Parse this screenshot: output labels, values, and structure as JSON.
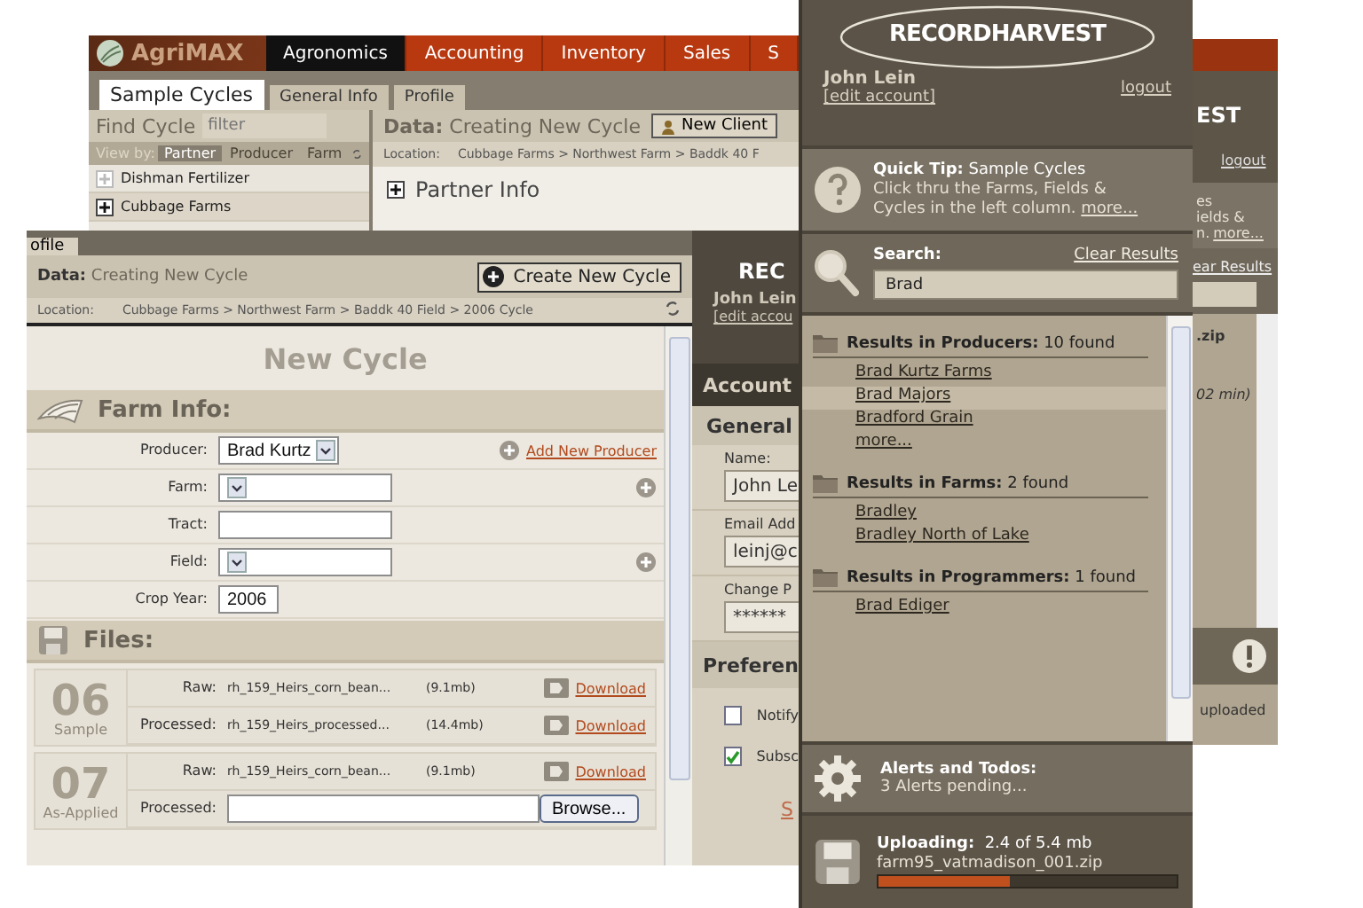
{
  "agrimax_window": {
    "app_name": "AgriMAX",
    "module_tabs": [
      {
        "label": "Agronomics",
        "selected": true
      },
      {
        "label": "Accounting",
        "selected": false
      },
      {
        "label": "Inventory",
        "selected": false
      },
      {
        "label": "Sales",
        "selected": false
      },
      {
        "label": "S",
        "selected": false
      }
    ],
    "page_tabs": [
      {
        "label": "Sample Cycles",
        "selected": true
      },
      {
        "label": "General Info",
        "selected": false
      },
      {
        "label": "Profile",
        "selected": false
      }
    ],
    "find_title": "Find Cycle",
    "filter": {
      "placeholder": "filter"
    },
    "view_by_label": "View by:",
    "view_by": [
      {
        "label": "Partner",
        "selected": true
      },
      {
        "label": "Producer",
        "selected": false
      },
      {
        "label": "Farm",
        "selected": false
      }
    ],
    "items": [
      {
        "label": "Dishman Fertilizer",
        "disabled": true
      },
      {
        "label": "Cubbage Farms",
        "disabled": false
      }
    ],
    "data_label": "Data:",
    "data_title": "Creating New Cycle",
    "new_client_button": "New Client",
    "location_label": "Location:",
    "location": "Cubbage Farms > Northwest Farm > Baddk 40 F",
    "section": "Partner Info"
  },
  "back_sidebar": {
    "logo_fragment": "EST",
    "logout": "logout",
    "tip_lines": [
      "es",
      "ields &"
    ],
    "tip_end": "n.",
    "more": "more...",
    "clear_fragment": "ear Results",
    "result_lines": [
      ".zip",
      "02 min)"
    ],
    "status": "uploaded"
  },
  "account_window": {
    "logo_fragment": "REC",
    "user": "John Lein",
    "edit_link": "[edit accou",
    "title": "Account",
    "section": "General",
    "fields": [
      {
        "label": "Name:",
        "value": "John Le"
      },
      {
        "label": "Email Add",
        "value": "leinj@c"
      },
      {
        "label": "Change P",
        "value": "******"
      }
    ],
    "preferences_title": "Preferen",
    "preferences": [
      {
        "label": "Notify",
        "checked": false
      },
      {
        "label": "Subsc",
        "checked": true
      }
    ],
    "link_fragment": "S"
  },
  "new_cycle_window": {
    "tab_fragment": "ofile",
    "data_label": "Data:",
    "data_title": "Creating New Cycle",
    "create_button": "Create New Cycle",
    "location_label": "Location:",
    "location": "Cubbage Farms > Northwest Farm > Baddk 40 Field > 2006 Cycle",
    "heading": "New Cycle",
    "farm_info": {
      "title": "Farm Info:",
      "fields": [
        {
          "kind": "select",
          "label": "Producer:",
          "value": "Brad Kurtz",
          "add_link": "Add New Producer"
        },
        {
          "kind": "select",
          "label": "Farm:",
          "add_button": true
        },
        {
          "kind": "text",
          "label": "Tract:"
        },
        {
          "kind": "select",
          "label": "Field:",
          "add_button": true
        },
        {
          "kind": "text",
          "label": "Crop Year:",
          "value": "2006"
        }
      ]
    },
    "files": {
      "title": "Files:",
      "groups": [
        {
          "number": "06",
          "type": "Sample",
          "files": [
            {
              "kind": "file",
              "label": "Raw:",
              "name": "rh_159_Heirs_corn_bean...",
              "size": "(9.1mb)",
              "link": "Download"
            },
            {
              "kind": "file",
              "label": "Processed:",
              "name": "rh_159_Heirs_processed...",
              "size": "(14.4mb)",
              "link": "Download"
            }
          ]
        },
        {
          "number": "07",
          "type": "As-Applied",
          "files": [
            {
              "kind": "file",
              "label": "Raw:",
              "name": "rh_159_Heirs_corn_bean...",
              "size": "(9.1mb)",
              "link": "Download"
            },
            {
              "kind": "upload",
              "label": "Processed:",
              "button": "Browse..."
            }
          ]
        }
      ]
    }
  },
  "sidebar": {
    "logo": "RECORDHARVEST",
    "user": "John Lein",
    "edit_link": "[edit account]",
    "logout": "logout",
    "quick_tip": {
      "label": "Quick Tip:",
      "title": "Sample Cycles",
      "text": "Click thru the Farms, Fields & Cycles in the left column.",
      "more": "more..."
    },
    "search": {
      "label": "Search:",
      "clear": "Clear Results",
      "value": "Brad"
    },
    "results": [
      {
        "title": "Results in Producers:",
        "count": "10 found",
        "items": [
          {
            "label": "Brad Kurtz Farms",
            "selected": false
          },
          {
            "label": "Brad Majors",
            "selected": true
          },
          {
            "label": "Bradford Grain",
            "selected": false
          }
        ],
        "more": "more..."
      },
      {
        "title": "Results in Farms:",
        "count": "2 found",
        "items": [
          {
            "label": "Bradley",
            "selected": false
          },
          {
            "label": "Bradley North of Lake",
            "selected": false
          }
        ]
      },
      {
        "title": "Results in Programmers:",
        "count": "1 found",
        "items": [
          {
            "label": "Brad Ediger",
            "selected": false
          }
        ]
      }
    ],
    "alerts": {
      "title": "Alerts and Todos:",
      "text": "3 Alerts pending..."
    },
    "upload": {
      "label": "Uploading:",
      "progress": "2.4 of 5.4 mb",
      "file": "farm95_vatmadison_001.zip",
      "level": 0.44
    }
  }
}
